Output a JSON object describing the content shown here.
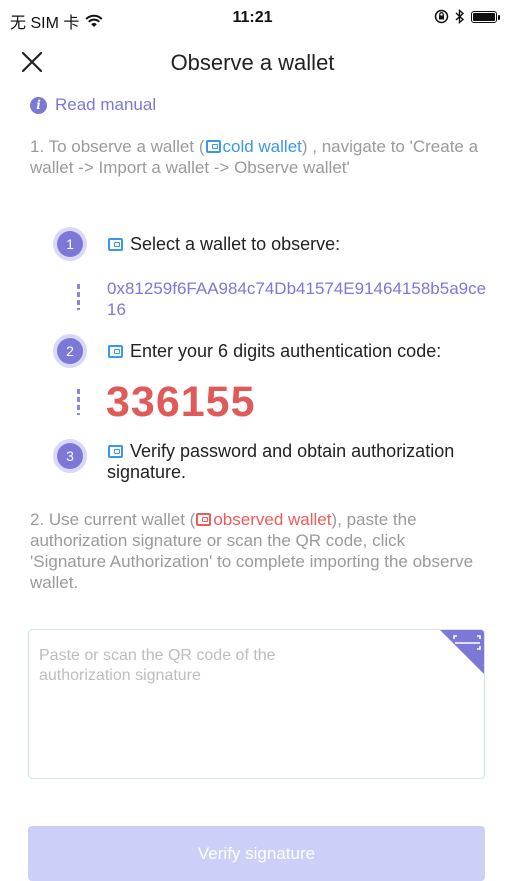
{
  "status": {
    "carrier": "无 SIM 卡",
    "time": "11:21"
  },
  "nav": {
    "title": "Observe a wallet"
  },
  "manual": {
    "label": "Read manual"
  },
  "instruction1": {
    "prefix": "1. To observe a wallet (",
    "tag": "cold wallet",
    "suffix": ") , navigate to 'Create a wallet -> Import a wallet -> Observe wallet'"
  },
  "steps": [
    {
      "number": "1",
      "text": "Select a wallet to observe:"
    },
    {
      "number": "2",
      "text": "Enter your 6 digits authentication code:"
    },
    {
      "number": "3",
      "text": "Verify password and obtain authorization signature."
    }
  ],
  "wallet_address": "0x81259f6FAA984c74Db41574E91464158b5a9ce16",
  "auth_code": "336155",
  "instruction2": {
    "prefix": "2. Use current wallet (",
    "tag": "observed wallet",
    "suffix": "), paste the authorization signature or scan the QR code, click 'Signature Authorization' to complete importing the observe wallet."
  },
  "signature_input": {
    "placeholder": "Paste or scan the QR code of the authorization signature",
    "value": ""
  },
  "verify_button": {
    "label": "Verify signature"
  },
  "colors": {
    "accent": "#7b78d8",
    "cold_wallet": "#3a98e8",
    "observed_wallet": "#ee5b5b",
    "code": "#e05a5a",
    "button_disabled": "#ccd0f8"
  },
  "icons": {
    "close": "close-icon",
    "info": "info-icon",
    "wallet": "wallet-icon",
    "scan": "scan-qr-icon"
  }
}
